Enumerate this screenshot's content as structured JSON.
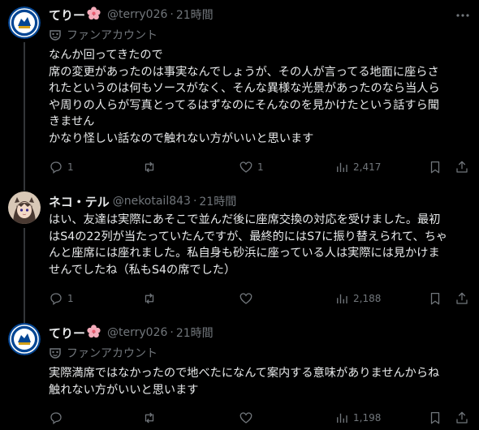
{
  "tweets": [
    {
      "author": {
        "name": "てりー",
        "name_emoji": "🌸",
        "handle": "@terry026",
        "separator": "·",
        "time": "21時間",
        "avatar_icon": "chelsea-crest-icon"
      },
      "badge": {
        "icon": "fan-account-mask-icon",
        "label": "ファンアカウント"
      },
      "lines": [
        "なんか回ってきたので",
        "席の変更があったのは事実なんでしょうが、その人が言ってる地面に座らさ",
        "れたというのは何もソースがなく、そんな異様な光景があったのなら当人ら",
        "や周りの人らが写真とってるはずなのにそんなのを見かけたという話すら聞",
        "きません",
        "かなり怪しい話なので触れない方がいいと思います"
      ],
      "stats": {
        "replies": "1",
        "reposts": "",
        "likes": "1",
        "views": "2,417"
      }
    },
    {
      "author": {
        "name": "ネコ・テル",
        "handle": "@nekotail843",
        "separator": "·",
        "time": "21時間",
        "avatar_icon": "anime-avatar-icon"
      },
      "lines": [
        "はい、友達は実際にあそこで並んだ後に座席交換の対応を受けました。最初",
        "はS4の22列が当たっていたんですが、最終的にはS7に振り替えられて、ちゃ",
        "んと座席には座れました。私自身も砂浜に座っている人は実際には見かけま",
        "せんでしたね（私もS4の席でした）"
      ],
      "stats": {
        "replies": "1",
        "reposts": "",
        "likes": "",
        "views": "2,188"
      }
    },
    {
      "author": {
        "name": "てりー",
        "name_emoji": "🌸",
        "handle": "@terry026",
        "separator": "·",
        "time": "21時間",
        "avatar_icon": "chelsea-crest-icon"
      },
      "badge": {
        "icon": "fan-account-mask-icon",
        "label": "ファンアカウント"
      },
      "lines": [
        "実際満席ではなかったので地べたになんて案内する意味がありませんからね",
        "触れない方がいいと思います"
      ],
      "stats": {
        "replies": "",
        "reposts": "",
        "likes": "",
        "views": "1,198"
      }
    }
  ],
  "icons": {
    "more": "more-horizontal-icon",
    "reply": "reply-bubble-icon",
    "repost": "repost-arrows-icon",
    "like": "heart-icon",
    "views": "views-chart-icon",
    "bookmark": "bookmark-icon",
    "share": "share-icon"
  },
  "colors": {
    "background": "#000000",
    "text": "#e7e9ea",
    "muted": "#71767b",
    "chelsea_blue": "#034694"
  }
}
